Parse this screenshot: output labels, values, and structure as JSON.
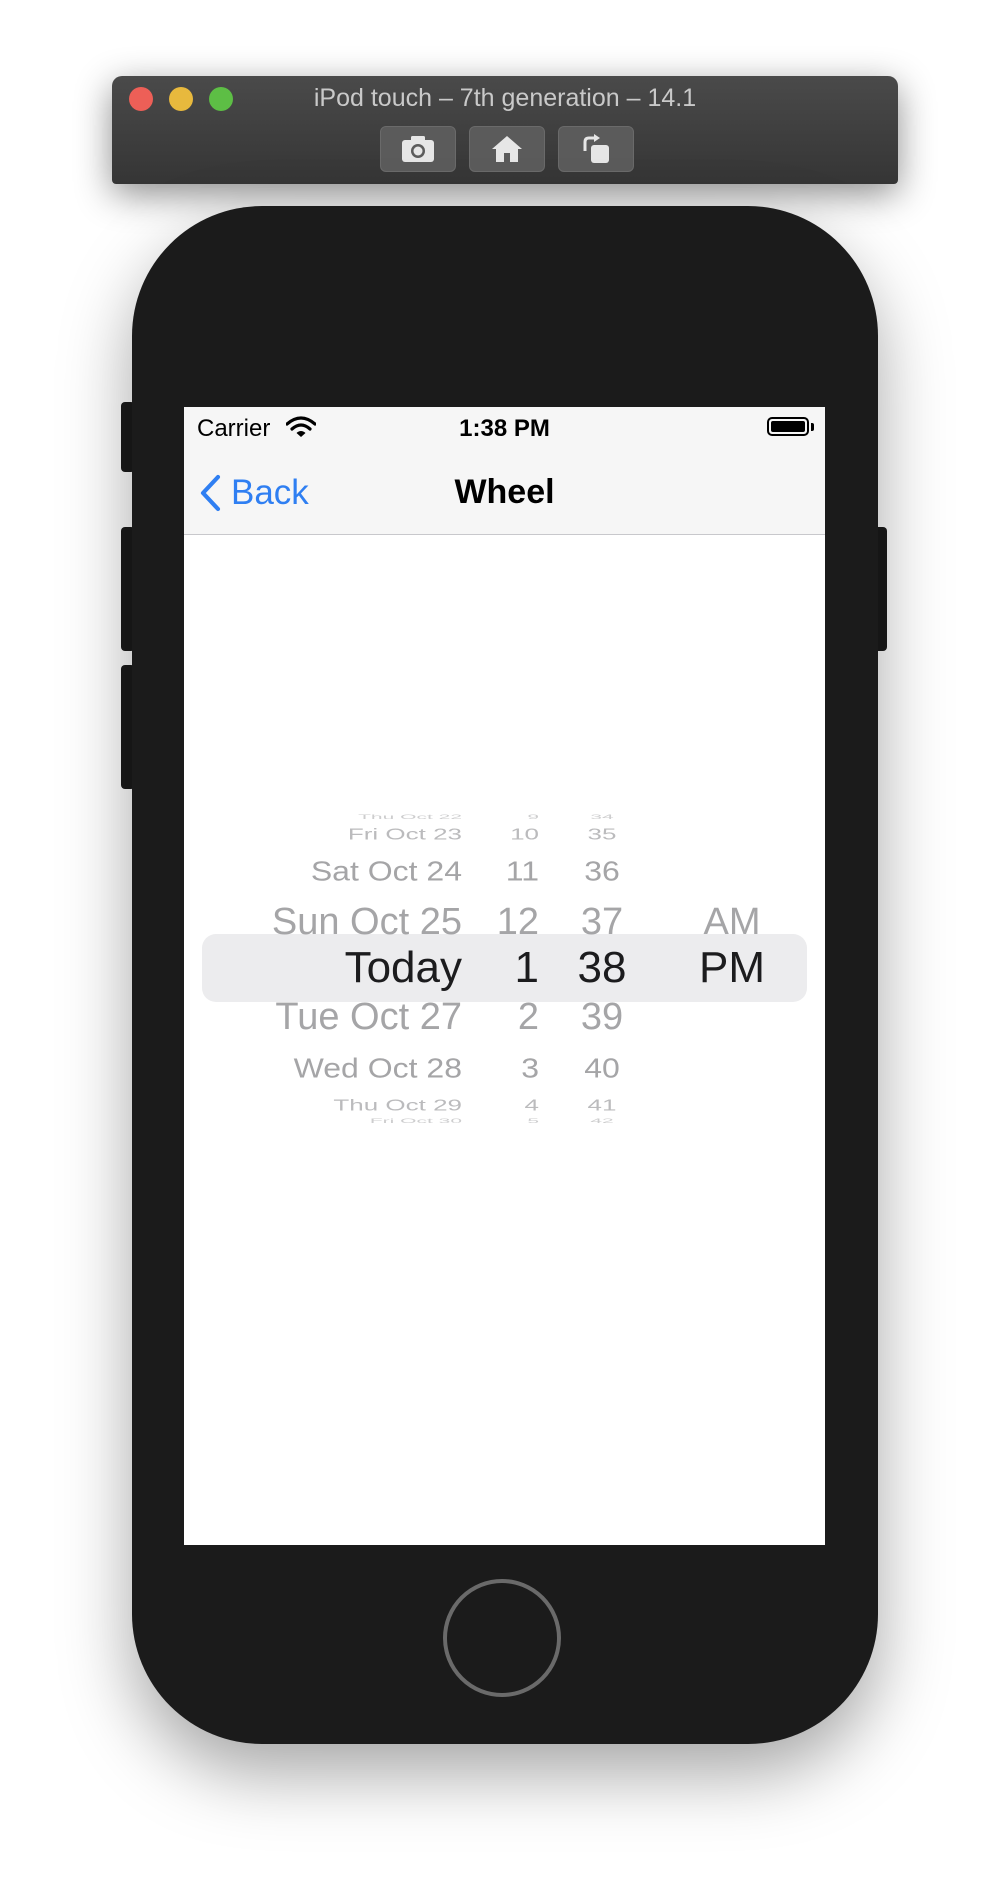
{
  "simulator": {
    "title": "iPod touch – 7th generation – 14.1",
    "toolbar": [
      "screenshot-icon",
      "home-icon",
      "rotate-icon"
    ]
  },
  "status_bar": {
    "carrier": "Carrier",
    "time": "1:38 PM"
  },
  "nav": {
    "back_label": "Back",
    "title": "Wheel"
  },
  "picker": {
    "dates": [
      "Thu Oct 22",
      "Fri Oct 23",
      "Sat Oct 24",
      "Sun Oct 25",
      "Today",
      "Tue Oct 27",
      "Wed Oct 28",
      "Thu Oct 29",
      "Fri Oct 30"
    ],
    "hours": [
      "9",
      "10",
      "11",
      "12",
      "1",
      "2",
      "3",
      "4",
      "5"
    ],
    "minutes": [
      "34",
      "35",
      "36",
      "37",
      "38",
      "39",
      "40",
      "41",
      "42"
    ],
    "periods": [
      "AM",
      "PM"
    ],
    "selected": {
      "date": "Today",
      "hour": "1",
      "minute": "38",
      "period": "PM"
    }
  },
  "colors": {
    "accent": "#2f7ff2",
    "picker_selected_text": "#1c1c1e",
    "picker_unselected_text": "#a5a5a7",
    "selection_band": "#ececee",
    "device_body": "#1b1b1b"
  }
}
